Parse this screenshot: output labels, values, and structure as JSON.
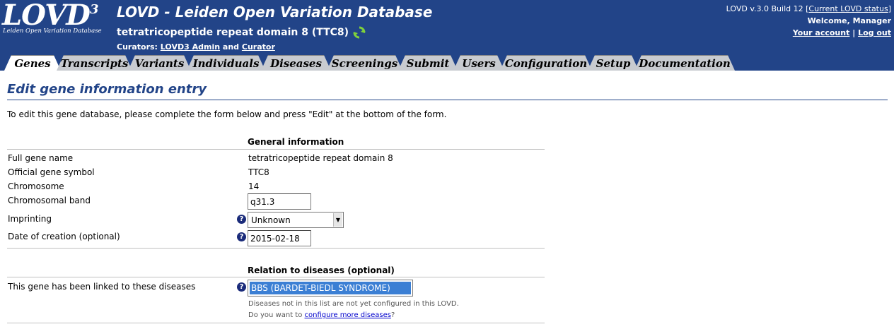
{
  "header": {
    "logo_text": "LOVD",
    "logo_version": "3",
    "logo_subtitle": "Leiden Open Variation Database",
    "app_title": "LOVD - Leiden Open Variation Database",
    "gene_title": "tetratricopeptide repeat domain 8 (TTC8)",
    "curators_label": "Curators:",
    "curator_1": "LOVD3 Admin",
    "curators_and": "and",
    "curator_2": "Curator",
    "build_text": "LOVD v.3.0 Build 12 [",
    "status_link": "Current LOVD status",
    "build_close": "]",
    "welcome": "Welcome, Manager",
    "account_link": "Your account",
    "separator": "|",
    "logout_link": "Log out"
  },
  "tabs": [
    {
      "label": "Genes",
      "active": true
    },
    {
      "label": "Transcripts"
    },
    {
      "label": "Variants"
    },
    {
      "label": "Individuals"
    },
    {
      "label": "Diseases"
    },
    {
      "label": "Screenings"
    },
    {
      "label": "Submit"
    },
    {
      "label": "Users"
    },
    {
      "label": "Configuration"
    },
    {
      "label": "Setup"
    },
    {
      "label": "Documentation"
    }
  ],
  "page": {
    "title": "Edit gene information entry",
    "intro": "To edit this gene database, please complete the form below and press \"Edit\" at the bottom of the form."
  },
  "form": {
    "general_heading": "General information",
    "full_name_label": "Full gene name",
    "full_name_value": "tetratricopeptide repeat domain 8",
    "symbol_label": "Official gene symbol",
    "symbol_value": "TTC8",
    "chromosome_label": "Chromosome",
    "chromosome_value": "14",
    "band_label": "Chromosomal band",
    "band_value": "q31.3",
    "imprinting_label": "Imprinting",
    "imprinting_value": "Unknown",
    "date_label": "Date of creation (optional)",
    "date_value": "2015-02-18",
    "help_glyph": "?",
    "relation_heading": "Relation to diseases (optional)",
    "diseases_label": "This gene has been linked to these diseases",
    "diseases_selected": "BBS (BARDET-BIEDL SYNDROME)",
    "diseases_note": "Diseases not in this list are not yet configured in this LOVD.",
    "configure_prefix": "Do you want to",
    "configure_link": "configure more diseases",
    "configure_suffix": "?"
  },
  "colors": {
    "header_bg": "#224488",
    "tab_bg": "#c8cbd0",
    "title_color": "#224488",
    "selected_option": "#3b7fd4"
  }
}
